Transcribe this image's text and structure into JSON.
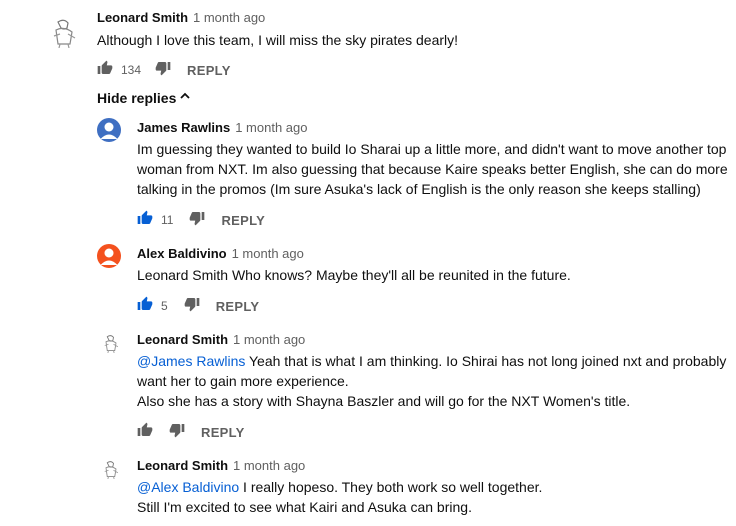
{
  "comments": [
    {
      "author": "Leonard Smith",
      "time": "1 month ago",
      "text": "Although I love this team, I will miss the sky pirates dearly!",
      "likes": "134",
      "reply_label": "REPLY"
    }
  ],
  "hide_replies_label": "Hide replies",
  "replies": [
    {
      "author": "James Rawlins",
      "time": "1 month ago",
      "lines": [
        "Im guessing they wanted to build Io Sharai up a little more, and didn't want to move another top",
        "woman from NXT. Im also guessing that because Kaire speaks better English, she can do more",
        "talking in the promos (Im sure Asuka's lack of English is the only reason she keeps stalling)"
      ],
      "likes": "11",
      "reply_label": "REPLY",
      "avatar_color": "#3f6fc2"
    },
    {
      "author": "Alex Baldivino",
      "time": "1 month ago",
      "lines": [
        "Leonard Smith Who knows? Maybe they'll all be reunited in the future."
      ],
      "likes": "5",
      "reply_label": "REPLY",
      "avatar_color": "#f4511e"
    },
    {
      "author": "Leonard Smith",
      "time": "1 month ago",
      "mention": "@James Rawlins",
      "line1_rest": " Yeah that is what I am thinking. Io Shirai has not long joined nxt and probably",
      "line2": "want her to gain more experience.",
      "line3": "Also she has a story with Shayna Baszler and will go for the NXT Women's title.",
      "reply_label": "REPLY"
    },
    {
      "author": "Leonard Smith",
      "time": "1 month ago",
      "mention": "@Alex Baldivino",
      "line1_rest": " I really hopeso. They both work so well together.",
      "line2": "Still I'm excited to see what Kairi and Asuka can bring."
    }
  ],
  "colors": {
    "accent": "#065fd4",
    "muted": "#606060"
  }
}
